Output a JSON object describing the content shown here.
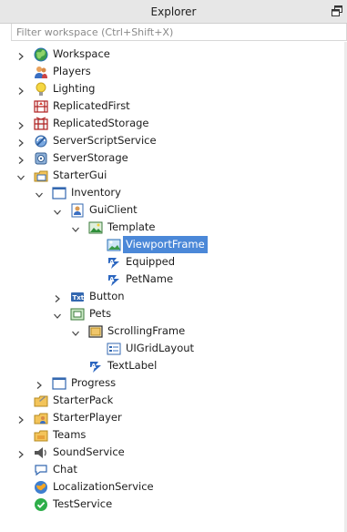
{
  "panel": {
    "title": "Explorer",
    "filter_placeholder": "Filter workspace (Ctrl+Shift+X)"
  },
  "items": [
    {
      "name": "Workspace",
      "depth": 0,
      "arrow": "right",
      "icon": "globe-icon"
    },
    {
      "name": "Players",
      "depth": 0,
      "arrow": "none",
      "icon": "players-icon"
    },
    {
      "name": "Lighting",
      "depth": 0,
      "arrow": "right",
      "icon": "lightbulb-icon"
    },
    {
      "name": "ReplicatedFirst",
      "depth": 0,
      "arrow": "none",
      "icon": "replicated-first-icon"
    },
    {
      "name": "ReplicatedStorage",
      "depth": 0,
      "arrow": "right",
      "icon": "replicated-storage-icon"
    },
    {
      "name": "ServerScriptService",
      "depth": 0,
      "arrow": "right",
      "icon": "server-script-service-icon"
    },
    {
      "name": "ServerStorage",
      "depth": 0,
      "arrow": "right",
      "icon": "server-storage-icon"
    },
    {
      "name": "StarterGui",
      "depth": 0,
      "arrow": "down",
      "icon": "starter-gui-icon"
    },
    {
      "name": "Inventory",
      "depth": 1,
      "arrow": "down",
      "icon": "screen-gui-icon"
    },
    {
      "name": "GuiClient",
      "depth": 2,
      "arrow": "down",
      "icon": "local-script-icon"
    },
    {
      "name": "Template",
      "depth": 3,
      "arrow": "down",
      "icon": "image-button-icon"
    },
    {
      "name": "ViewportFrame",
      "depth": 4,
      "arrow": "none",
      "icon": "viewport-frame-icon",
      "selected": true
    },
    {
      "name": "Equipped",
      "depth": 4,
      "arrow": "none",
      "icon": "text-label-icon"
    },
    {
      "name": "PetName",
      "depth": 4,
      "arrow": "none",
      "icon": "text-label-icon"
    },
    {
      "name": "Button",
      "depth": 2,
      "arrow": "right",
      "icon": "text-button-icon"
    },
    {
      "name": "Pets",
      "depth": 2,
      "arrow": "down",
      "icon": "frame-icon"
    },
    {
      "name": "ScrollingFrame",
      "depth": 3,
      "arrow": "down",
      "icon": "scrolling-frame-icon"
    },
    {
      "name": "UIGridLayout",
      "depth": 4,
      "arrow": "none",
      "icon": "grid-layout-icon"
    },
    {
      "name": "TextLabel",
      "depth": 3,
      "arrow": "none",
      "icon": "text-label-icon"
    },
    {
      "name": "Progress",
      "depth": 1,
      "arrow": "right",
      "icon": "screen-gui-icon"
    },
    {
      "name": "StarterPack",
      "depth": 0,
      "arrow": "none",
      "icon": "starter-pack-icon"
    },
    {
      "name": "StarterPlayer",
      "depth": 0,
      "arrow": "right",
      "icon": "starter-player-icon"
    },
    {
      "name": "Teams",
      "depth": 0,
      "arrow": "none",
      "icon": "teams-icon"
    },
    {
      "name": "SoundService",
      "depth": 0,
      "arrow": "right",
      "icon": "speaker-icon"
    },
    {
      "name": "Chat",
      "depth": 0,
      "arrow": "none",
      "icon": "chat-icon"
    },
    {
      "name": "LocalizationService",
      "depth": 0,
      "arrow": "none",
      "icon": "localization-icon"
    },
    {
      "name": "TestService",
      "depth": 0,
      "arrow": "none",
      "icon": "checkmark-icon"
    }
  ],
  "colors": {
    "selection": "#4b88d8",
    "title_bg": "#e7e7e7"
  }
}
